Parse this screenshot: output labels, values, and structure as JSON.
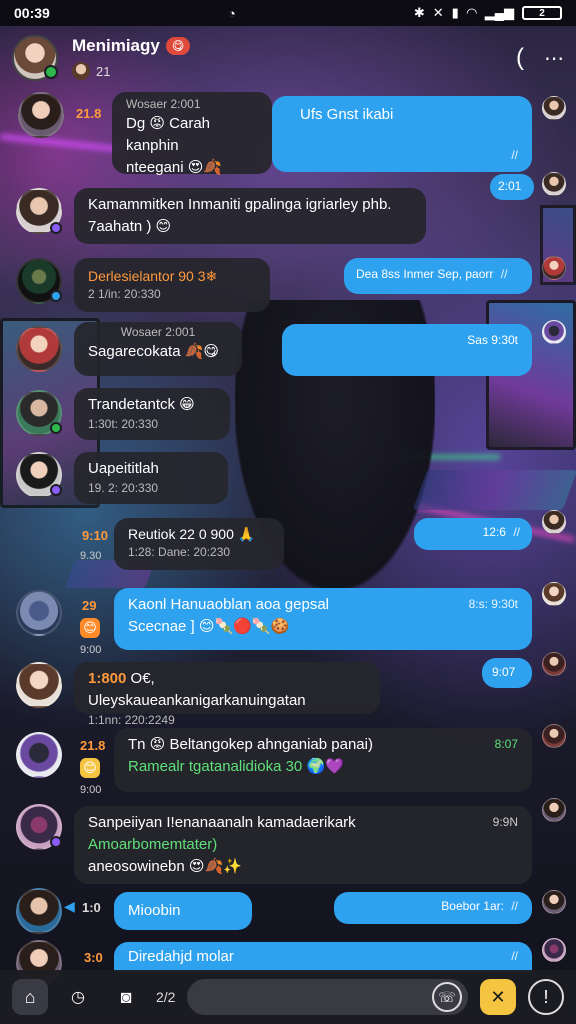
{
  "status_bar": {
    "time": "00:39",
    "battery": "2"
  },
  "header": {
    "title": "Menimiagy",
    "title_badge": "😋",
    "subtitle_count": "21",
    "back_label": "(",
    "more_label": "⋯"
  },
  "messages": [
    {
      "id": "m1",
      "side_label": "21.8",
      "time": "Wosaer 2:001",
      "text": "Dg 😡 Carah kanphin",
      "text2": "nteegani 😍🍂"
    },
    {
      "id": "m2",
      "text": "Ufs Gnst ikabi",
      "time": "",
      "ticks": "//"
    },
    {
      "id": "m3",
      "time": "2:01"
    },
    {
      "id": "m4",
      "text": "Kamammitken Inmaniti gpalinga igriarley phb.",
      "text2": "7aahatn ) 😊"
    },
    {
      "id": "m5",
      "text": "Derlesielantor 90 3❄",
      "time": "2 1/in: 20:330"
    },
    {
      "id": "m6",
      "text": "Dea 8ss Inmer Sep, paorr",
      "ticks": "//"
    },
    {
      "id": "m7",
      "time": "Wosaer 2:001",
      "text": "Sagarecokata 🍂😋"
    },
    {
      "id": "m8",
      "text": "Sas 9:30t"
    },
    {
      "id": "m9",
      "text": "Trandetantck 😁",
      "time": "1:30t: 20:330"
    },
    {
      "id": "m10",
      "text": "Uapeititlah",
      "time": "19. 2: 20:330"
    },
    {
      "id": "m11",
      "side_label": "9:10",
      "side_time": "9.30",
      "text": "Reutiok 22 0 900 🙏",
      "time": "1:28: Dane: 20:230"
    },
    {
      "id": "m12",
      "time": "12:6",
      "ticks": "//"
    },
    {
      "id": "m13",
      "side_label": "29",
      "side_time": "9:00",
      "text": "Kaonl Hanuaoblan aoa gepsal",
      "text2": "Scecnae ] 😊🍡🔴🍡🍪",
      "time": "8:s: 9:30t"
    },
    {
      "id": "m14",
      "time": "9:07"
    },
    {
      "id": "m15",
      "side_label": "1:800",
      "text": "O€, Uleyskaueankanigarkanuingatan",
      "time": "1:1nn: 220:2249"
    },
    {
      "id": "m16",
      "side_label": "21.8",
      "side_time": "9:00",
      "text": "Tn 😡 Beltangokep ahnganiab panai)",
      "text2": "Ramealr tgatanalidioka 30 🌍💜",
      "time": "8:07"
    },
    {
      "id": "m17",
      "text": "Sanpeiiyan I!enanaanaln kamadaerikark",
      "text2": "Amoarbomemtater)",
      "text3": "aneosowinebn 😍🍂✨",
      "time": "9:9N"
    },
    {
      "id": "m18",
      "side_label": "1:0",
      "text": "Mioobin"
    },
    {
      "id": "m19",
      "text": "Boebor 1ar:",
      "ticks": "//"
    },
    {
      "id": "m20",
      "side_label": "3:0",
      "text": "Diredahjd molar",
      "ticks": "//"
    }
  ],
  "bottom_bar": {
    "home_icon": "home-icon",
    "reaction_count": "2/2",
    "input_placeholder": ""
  }
}
